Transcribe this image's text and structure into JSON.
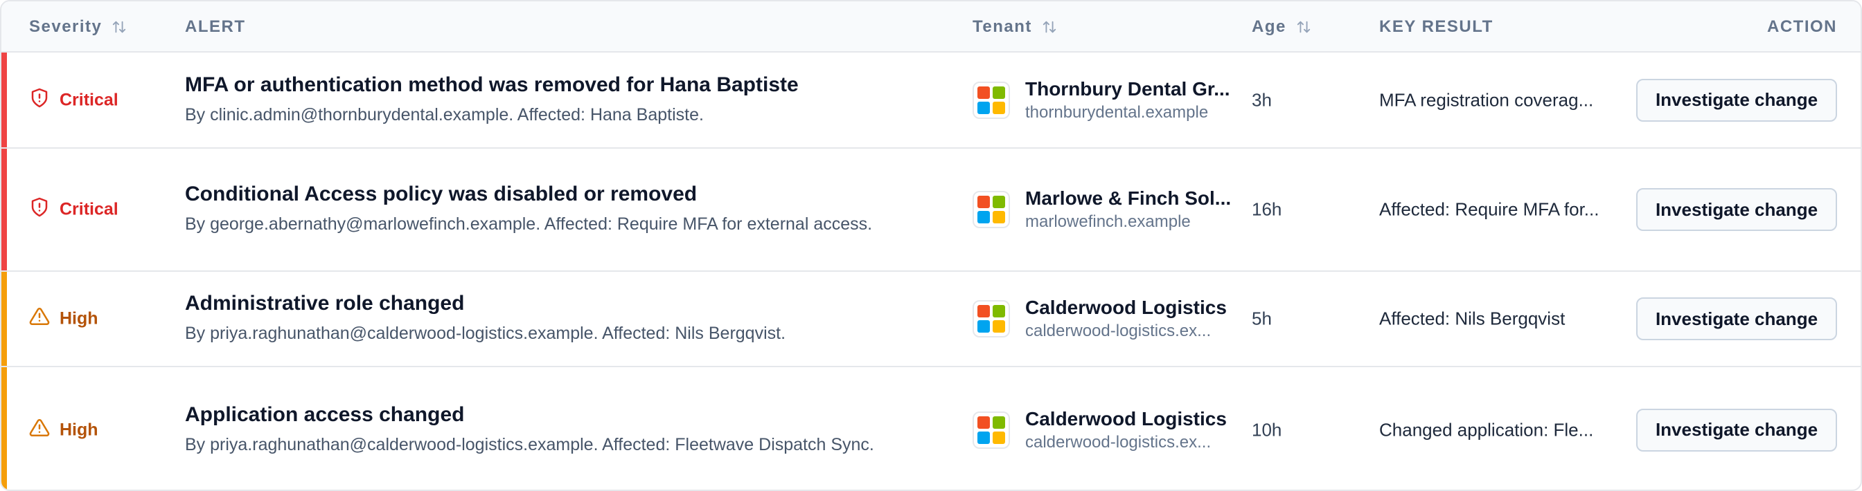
{
  "colors": {
    "critical": "#dc2626",
    "critical_bar": "#ef4444",
    "high": "#b45309",
    "high_bar": "#f59e0b",
    "logo": [
      "#f25022",
      "#7fba00",
      "#00a4ef",
      "#ffb900"
    ]
  },
  "header": {
    "severity": "Severity",
    "alert": "ALERT",
    "tenant": "Tenant",
    "age": "Age",
    "key_result": "KEY RESULT",
    "action": "ACTION"
  },
  "rows": [
    {
      "severity": "Critical",
      "severity_icon": "shield-alert-icon",
      "title": "MFA or authentication method was removed for Hana Baptiste",
      "desc": "By clinic.admin@thornburydental.example. Affected: Hana Baptiste.",
      "tenant_name": "Thornbury Dental Gr...",
      "tenant_domain": "thornburydental.example",
      "age": "3h",
      "key_result": "MFA registration coverag...",
      "action": "Investigate change"
    },
    {
      "severity": "Critical",
      "severity_icon": "shield-alert-icon",
      "title": "Conditional Access policy was disabled or removed",
      "desc": "By george.abernathy@marlowefinch.example. Affected: Require MFA for external access.",
      "tenant_name": "Marlowe & Finch Sol...",
      "tenant_domain": "marlowefinch.example",
      "age": "16h",
      "key_result": "Affected: Require MFA for...",
      "action": "Investigate change"
    },
    {
      "severity": "High",
      "severity_icon": "warning-triangle-icon",
      "title": "Administrative role changed",
      "desc": "By priya.raghunathan@calderwood-logistics.example. Affected: Nils Bergqvist.",
      "tenant_name": "Calderwood Logistics",
      "tenant_domain": "calderwood-logistics.ex...",
      "age": "5h",
      "key_result": "Affected: Nils Bergqvist",
      "action": "Investigate change"
    },
    {
      "severity": "High",
      "severity_icon": "warning-triangle-icon",
      "title": "Application access changed",
      "desc": "By priya.raghunathan@calderwood-logistics.example. Affected: Fleetwave Dispatch Sync.",
      "tenant_name": "Calderwood Logistics",
      "tenant_domain": "calderwood-logistics.ex...",
      "age": "10h",
      "key_result": "Changed application: Fle...",
      "action": "Investigate change"
    }
  ]
}
